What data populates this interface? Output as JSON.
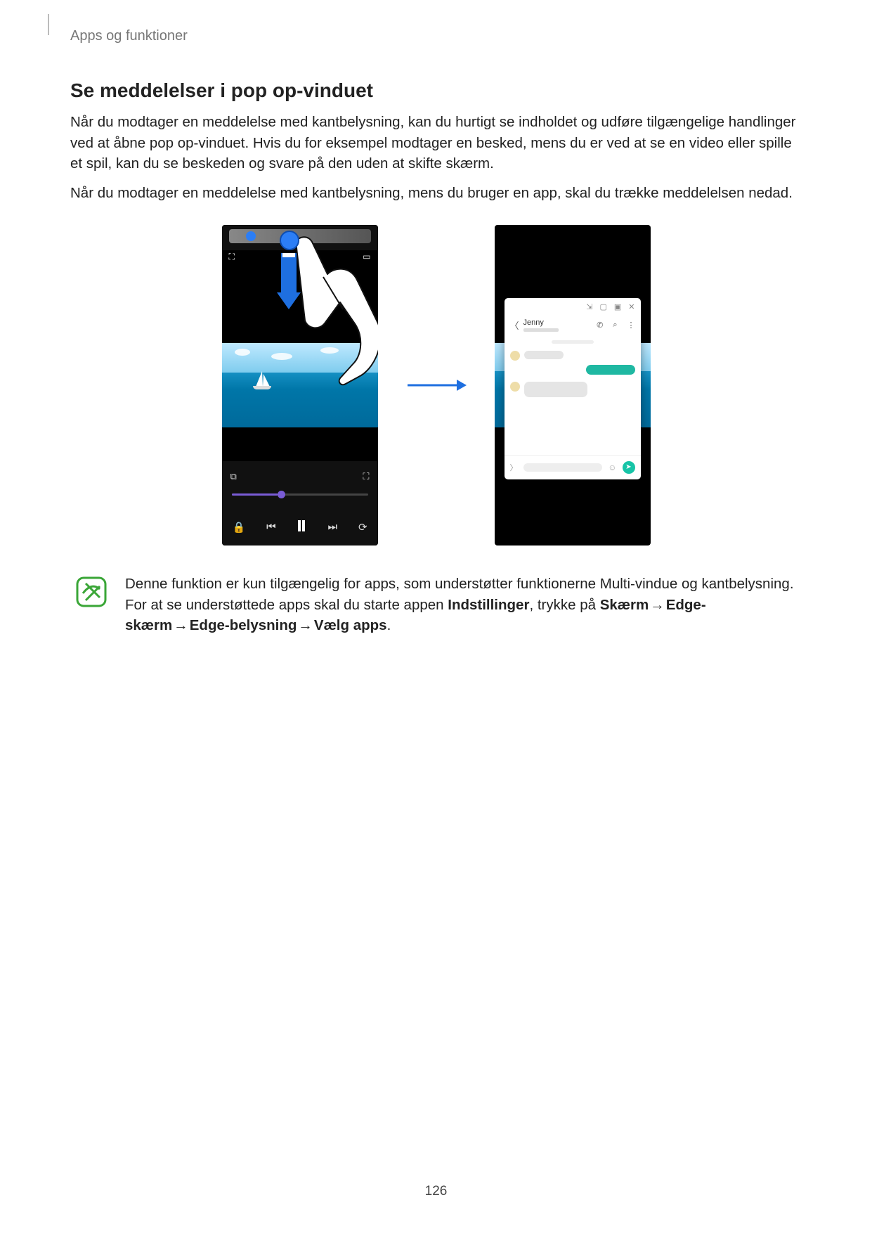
{
  "breadcrumb": "Apps og funktioner",
  "section_title": "Se meddelelser i pop op-vinduet",
  "para1": "Når du modtager en meddelelse med kantbelysning, kan du hurtigt se indholdet og udføre tilgængelige handlinger ved at åbne pop op-vinduet. Hvis du for eksempel modtager en besked, mens du er ved at se en video eller spille et spil, kan du se beskeden og svare på den uden at skifte skærm.",
  "para2": "Når du modtager en meddelelse med kantbelysning, mens du bruger en app, skal du trække meddelelsen nedad.",
  "popup": {
    "contact_name": "Jenny",
    "titlebar": {
      "collapse": "⇲",
      "min": "▢",
      "max": "▣",
      "close": "✕"
    },
    "actions": {
      "call": "📞",
      "search": "🔍",
      "more": "⋮"
    },
    "send": "➤"
  },
  "note": {
    "lead": "Denne funktion er kun tilgængelig for apps, som understøtter funktionerne Multi-vindue og kantbelysning. For at se understøttede apps skal du starte appen ",
    "settings": "Indstillinger",
    "mid": ", trykke på ",
    "path1": "Skærm",
    "path2": "Edge-skærm",
    "path3": "Edge-belysning",
    "path4": "Vælg apps",
    "arrow": "→",
    "period": "."
  },
  "page_number": "126"
}
